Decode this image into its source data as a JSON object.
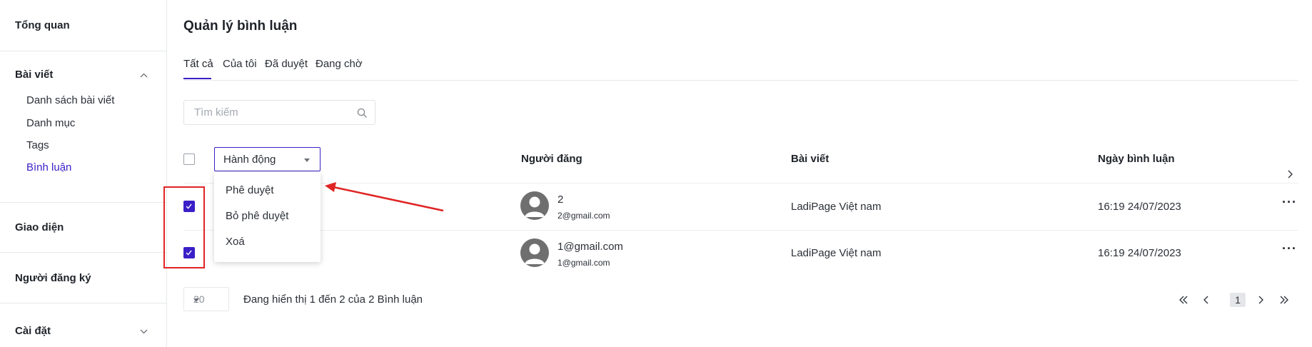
{
  "sidebar": {
    "overview": "Tổng quan",
    "posts": "Bài viết",
    "posts_items": [
      "Danh sách bài viết",
      "Danh mục",
      "Tags",
      "Bình luận"
    ],
    "theme": "Giao diện",
    "subscribers": "Người đăng ký",
    "settings": "Cài đặt"
  },
  "page": {
    "title": "Quản lý bình luận",
    "tabs": [
      "Tất cả",
      "Của tôi",
      "Đã duyệt",
      "Đang chờ"
    ]
  },
  "search": {
    "placeholder": "Tìm kiếm"
  },
  "actions": {
    "label": "Hành động",
    "options": [
      "Phê duyệt",
      "Bỏ phê duyệt",
      "Xoá"
    ]
  },
  "table": {
    "headers": [
      "Người đăng",
      "Bài viết",
      "Ngày bình luận"
    ],
    "rows": [
      {
        "name": "2",
        "email": "2@gmail.com",
        "post": "LadiPage Việt nam",
        "date": "16:19 24/07/2023",
        "checked": true
      },
      {
        "name": "1@gmail.com",
        "email": "1@gmail.com",
        "post": "LadiPage Việt nam",
        "date": "16:19 24/07/2023",
        "checked": true
      }
    ]
  },
  "pagination": {
    "page_size": "20",
    "info": "Đang hiển thị 1 đến 2 của 2 Bình luận",
    "current_page": "1"
  },
  "colors": {
    "accent": "#3a1fc7",
    "annotation": "#e02424"
  }
}
